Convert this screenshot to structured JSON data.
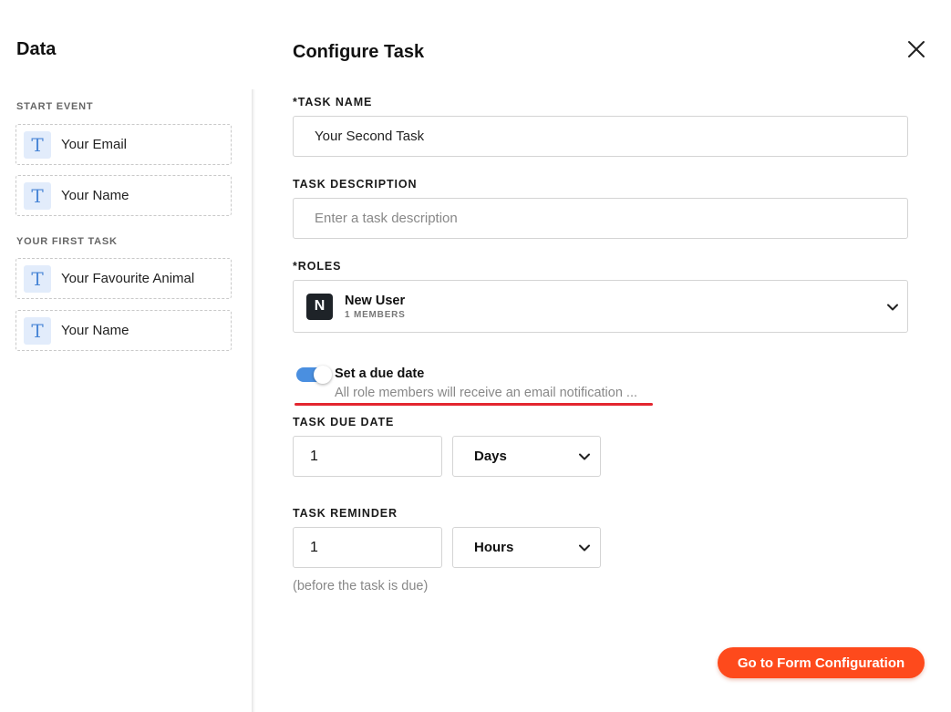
{
  "sidebar": {
    "title": "Data",
    "sections": [
      {
        "label": "START EVENT",
        "items": [
          {
            "icon": "text-field-icon",
            "glyph": "T",
            "label": "Your Email"
          },
          {
            "icon": "text-field-icon",
            "glyph": "T",
            "label": "Your Name"
          }
        ]
      },
      {
        "label": "YOUR FIRST TASK",
        "items": [
          {
            "icon": "text-field-icon",
            "glyph": "T",
            "label": "Your Favourite Animal"
          },
          {
            "icon": "text-field-icon",
            "glyph": "T",
            "label": "Your Name"
          }
        ]
      }
    ]
  },
  "main": {
    "title": "Configure Task",
    "close_icon": "close-icon",
    "task_name": {
      "label": "*TASK NAME",
      "value": "Your Second Task"
    },
    "task_description": {
      "label": "TASK DESCRIPTION",
      "value": "",
      "placeholder": "Enter a task description"
    },
    "roles": {
      "label": "*ROLES",
      "selected": {
        "initial": "N",
        "name": "New User",
        "members": "1 MEMBERS"
      }
    },
    "due_date_toggle": {
      "enabled": true,
      "title": "Set a due date",
      "description": "All role members will receive an email notification ..."
    },
    "task_due_date": {
      "label": "TASK DUE DATE",
      "value": "1",
      "unit": "Days"
    },
    "task_reminder": {
      "label": "TASK REMINDER",
      "value": "1",
      "unit": "Hours",
      "hint": "(before the task is due)"
    },
    "primary_button": {
      "label": "Go to Form Configuration"
    }
  },
  "colors": {
    "accent": "#fe4a1c",
    "toggle": "#4a8fe0",
    "highlight": "#e3262f",
    "field_icon_bg": "#e2ecfb"
  }
}
